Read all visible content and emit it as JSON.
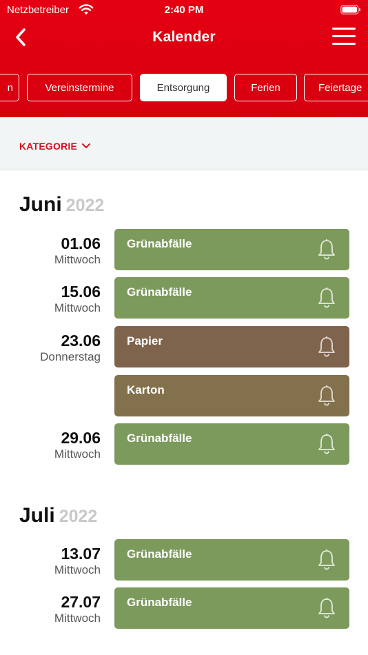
{
  "status": {
    "carrier": "Netzbetreiber",
    "time": "2:40 PM"
  },
  "nav": {
    "title": "Kalender"
  },
  "tabs": [
    {
      "label": "n"
    },
    {
      "label": "Vereinstermine"
    },
    {
      "label": "Entsorgung"
    },
    {
      "label": "Ferien"
    },
    {
      "label": "Feiertage"
    }
  ],
  "filter": {
    "category_label": "KATEGORIE"
  },
  "colors": {
    "header": "#e40012",
    "green": "#7c9a5b",
    "brown_papier": "#7f644d",
    "brown_karton": "#83704c",
    "accent": "#d3101c"
  },
  "months": [
    {
      "name": "Juni",
      "year": "2022",
      "entries": [
        {
          "date": "01.06",
          "weekday": "Mittwoch",
          "label": "Grünabfälle",
          "icon": "bell-icon"
        },
        {
          "date": "15.06",
          "weekday": "Mittwoch",
          "label": "Grünabfälle",
          "icon": "bell-icon"
        },
        {
          "date": "23.06",
          "weekday": "Donnerstag",
          "label": "Papier",
          "icon": "bell-icon"
        },
        {
          "label": "Karton",
          "icon": "bell-icon"
        },
        {
          "date": "29.06",
          "weekday": "Mittwoch",
          "label": "Grünabfälle",
          "icon": "bell-icon"
        }
      ]
    },
    {
      "name": "Juli",
      "year": "2022",
      "entries": [
        {
          "date": "13.07",
          "weekday": "Mittwoch",
          "label": "Grünabfälle",
          "icon": "bell-icon"
        },
        {
          "date": "27.07",
          "weekday": "Mittwoch",
          "label": "Grünabfälle",
          "icon": "bell-icon"
        }
      ]
    }
  ]
}
